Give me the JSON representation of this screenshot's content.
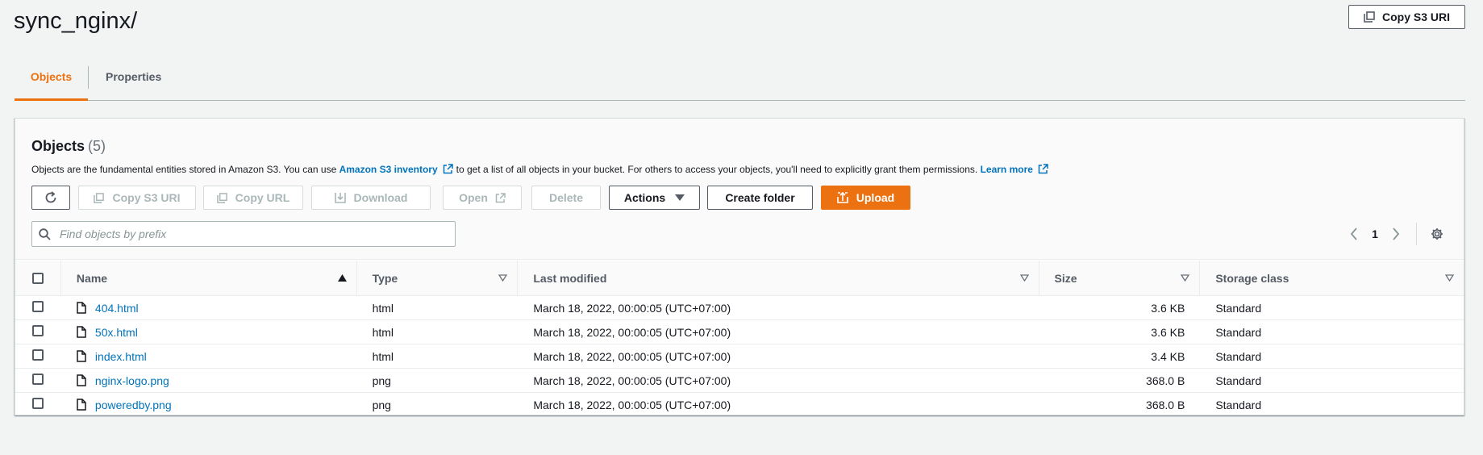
{
  "page": {
    "title": "sync_nginx/",
    "copy_s3_uri_label": "Copy S3 URI"
  },
  "tabs": [
    {
      "label": "Objects",
      "active": true
    },
    {
      "label": "Properties",
      "active": false
    }
  ],
  "objects_panel": {
    "title": "Objects",
    "count": "(5)",
    "description_part1": "Objects are the fundamental entities stored in Amazon S3. You can use",
    "inventory_link": "Amazon S3 inventory",
    "description_part2": "to get a list of all objects in your bucket. For others to access your objects, you'll need to explicitly grant them permissions.",
    "learn_more_link": "Learn more",
    "toolbar": {
      "refresh_icon": "refresh-icon",
      "copy_s3_uri": "Copy S3 URI",
      "copy_url": "Copy URL",
      "download": "Download",
      "open": "Open",
      "delete": "Delete",
      "actions": "Actions",
      "create_folder": "Create folder",
      "upload": "Upload"
    },
    "search": {
      "placeholder": "Find objects by prefix",
      "value": ""
    },
    "pagination": {
      "current_page": "1"
    },
    "columns": [
      "Name",
      "Type",
      "Last modified",
      "Size",
      "Storage class"
    ],
    "rows": [
      {
        "name": "404.html",
        "type": "html",
        "last_modified": "March 18, 2022, 00:00:05 (UTC+07:00)",
        "size": "3.6 KB",
        "storage_class": "Standard"
      },
      {
        "name": "50x.html",
        "type": "html",
        "last_modified": "March 18, 2022, 00:00:05 (UTC+07:00)",
        "size": "3.6 KB",
        "storage_class": "Standard"
      },
      {
        "name": "index.html",
        "type": "html",
        "last_modified": "March 18, 2022, 00:00:05 (UTC+07:00)",
        "size": "3.4 KB",
        "storage_class": "Standard"
      },
      {
        "name": "nginx-logo.png",
        "type": "png",
        "last_modified": "March 18, 2022, 00:00:05 (UTC+07:00)",
        "size": "368.0 B",
        "storage_class": "Standard"
      },
      {
        "name": "poweredby.png",
        "type": "png",
        "last_modified": "March 18, 2022, 00:00:05 (UTC+07:00)",
        "size": "368.0 B",
        "storage_class": "Standard"
      }
    ]
  },
  "colors": {
    "accent_orange": "#ec7211",
    "link_blue": "#0073bb",
    "background": "#f2f3f3"
  }
}
